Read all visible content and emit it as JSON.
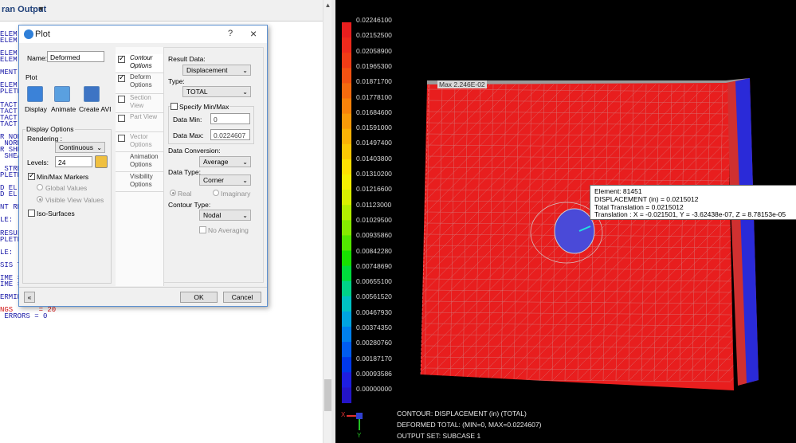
{
  "output": {
    "title": "ran Output",
    "lines": [
      {
        "text": "ELEM",
        "cls": "blue"
      },
      {
        "text": "ELEM",
        "cls": "blue"
      },
      {
        "text": "",
        "cls": ""
      },
      {
        "text": "ELEM",
        "cls": "blue"
      },
      {
        "text": "ELEM",
        "cls": "blue"
      },
      {
        "text": "",
        "cls": ""
      },
      {
        "text": "MENT",
        "cls": "blue"
      },
      {
        "text": "",
        "cls": ""
      },
      {
        "text": "ELEM",
        "cls": "blue"
      },
      {
        "text": "PLETE",
        "cls": "blue"
      },
      {
        "text": "",
        "cls": ""
      },
      {
        "text": "TACT",
        "cls": "blue"
      },
      {
        "text": "TACT",
        "cls": "blue"
      },
      {
        "text": "TACT",
        "cls": "blue"
      },
      {
        "text": "TACT",
        "cls": "blue"
      },
      {
        "text": "",
        "cls": ""
      },
      {
        "text": "R NOR",
        "cls": "blue"
      },
      {
        "text": " NORM",
        "cls": "blue"
      },
      {
        "text": "R SHE",
        "cls": "blue"
      },
      {
        "text": " SHEA",
        "cls": "blue"
      },
      {
        "text": "",
        "cls": ""
      },
      {
        "text": " STRE",
        "cls": "blue"
      },
      {
        "text": "PLETE",
        "cls": "blue"
      },
      {
        "text": "",
        "cls": ""
      },
      {
        "text": "D EL",
        "cls": "blue"
      },
      {
        "text": "D EL",
        "cls": "blue"
      },
      {
        "text": "",
        "cls": ""
      },
      {
        "text": "NT RE",
        "cls": "blue"
      },
      {
        "text": "",
        "cls": ""
      },
      {
        "text": "LE:",
        "cls": "blue"
      },
      {
        "text": "",
        "cls": ""
      },
      {
        "text": "RESUL",
        "cls": "blue"
      },
      {
        "text": "PLETE",
        "cls": "blue"
      },
      {
        "text": "",
        "cls": ""
      },
      {
        "text": "LE:",
        "cls": "blue"
      },
      {
        "text": "",
        "cls": ""
      },
      {
        "text": "SIS T",
        "cls": "blue"
      },
      {
        "text": "",
        "cls": ""
      },
      {
        "text": "IME =",
        "cls": "blue"
      },
      {
        "text": "IME =",
        "cls": "blue"
      },
      {
        "text": "",
        "cls": ""
      },
      {
        "text": "ERMINATED NORMALLY",
        "cls": "blue"
      },
      {
        "text": "",
        "cls": ""
      },
      {
        "text": "NGS      = 20",
        "cls": "red"
      },
      {
        "text": " ERRORS = 0",
        "cls": "blue"
      }
    ]
  },
  "dialog": {
    "title": "Plot",
    "help": "?",
    "close": "×",
    "name_label": "Name:",
    "name_value": "Deformed",
    "plot_group": "Plot",
    "buttons": {
      "display": "Display",
      "animate": "Animate",
      "create_avi": "Create AVI"
    },
    "display_options": "Display Options",
    "rendering_label": "Rendering :",
    "rendering_value": "Continuous",
    "levels_label": "Levels:",
    "levels_value": "24",
    "minmax_label": "Min/Max Markers",
    "global_values": "Global Values",
    "visible_values": "Visible View Values",
    "iso_surfaces": "Iso-Surfaces",
    "ok": "OK",
    "cancel": "Cancel",
    "tabs": [
      {
        "label": "Contour Options",
        "checked": true,
        "selected": true,
        "disabled": false
      },
      {
        "label": "Deform Options",
        "checked": true,
        "selected": false,
        "disabled": false
      },
      {
        "label": "Section View",
        "checked": false,
        "selected": false,
        "disabled": true
      },
      {
        "label": "Part View",
        "checked": false,
        "selected": false,
        "disabled": true
      },
      {
        "label": "Vector Options",
        "checked": false,
        "selected": false,
        "disabled": true
      },
      {
        "label": "Animation Options",
        "checked": null,
        "selected": false,
        "disabled": false
      },
      {
        "label": "Visibility Options",
        "checked": null,
        "selected": false,
        "disabled": false
      }
    ],
    "contour": {
      "result_data_label": "Result Data:",
      "result_data_value": "Displacement",
      "type_label": "Type:",
      "type_value": "TOTAL",
      "specify_minmax": "Specify Min/Max",
      "data_min_label": "Data Min:",
      "data_min_value": "0",
      "data_max_label": "Data Max:",
      "data_max_value": "0.0224607",
      "data_conversion_label": "Data Conversion:",
      "data_conversion_value": "Average",
      "data_type_label": "Data Type:",
      "data_type_value": "Corner",
      "real": "Real",
      "imaginary": "Imaginary",
      "contour_type_label": "Contour Type:",
      "contour_type_value": "Nodal",
      "no_averaging": "No Averaging"
    }
  },
  "view": {
    "legend_values": [
      "0.02246100",
      "0.02152500",
      "0.02058900",
      "0.01965300",
      "0.01871700",
      "0.01778100",
      "0.01684600",
      "0.01591000",
      "0.01497400",
      "0.01403800",
      "0.01310200",
      "0.01216600",
      "0.01123000",
      "0.01029500",
      "0.00935860",
      "0.00842280",
      "0.00748690",
      "0.00655100",
      "0.00561520",
      "0.00467930",
      "0.00374350",
      "0.00280760",
      "0.00187170",
      "0.00093586",
      "0.00000000"
    ],
    "legend_colors": [
      "#e81e1e",
      "#ee2a1c",
      "#f03c16",
      "#f35212",
      "#f56a0e",
      "#f8820a",
      "#f99a08",
      "#fbb206",
      "#fcc804",
      "#fde002",
      "#f5ef02",
      "#d8f000",
      "#b2ee00",
      "#86ea00",
      "#52e600",
      "#18e000",
      "#00dc3c",
      "#00d288",
      "#00c2c4",
      "#00a4e0",
      "#0080ec",
      "#005cf0",
      "#0038ea",
      "#1e1ee0",
      "#2414c8"
    ],
    "max_label": "Max 2.246E-02",
    "tooltip": [
      "Element: 81451",
      "DISPLACEMENT (in)  = 0.0215012",
      "Total Translation = 0.0215012",
      "Translation : X = -0.021501, Y = -3.62438e-07, Z = 8.78153e-05"
    ],
    "caption": [
      "CONTOUR: DISPLACEMENT (in) (TOTAL)",
      "DEFORMED TOTAL: (MIN=0, MAX=0.0224607)",
      "OUTPUT SET: SUBCASE 1"
    ],
    "axis_x": "X",
    "axis_y": "Y",
    "colors": {
      "fringe_max": "#e81e1e",
      "fringe_min": "#2020d0",
      "background": "#000000",
      "mesh": "#bdbdbd"
    }
  }
}
